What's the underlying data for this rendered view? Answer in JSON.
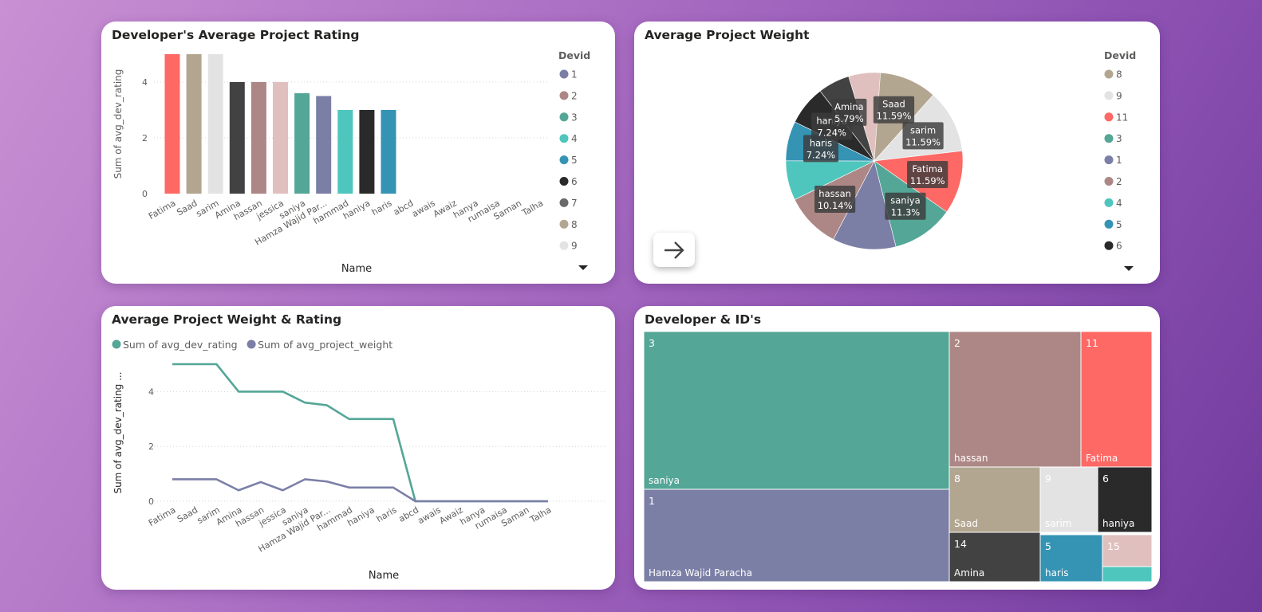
{
  "colors": {
    "1": "#7b7fa6",
    "2": "#ad8785",
    "3": "#54a697",
    "4": "#4fc6bd",
    "5": "#3593b4",
    "6": "#2a2a2a",
    "7": "#6a6a6a",
    "8": "#b3a691",
    "9": "#e3e3e3",
    "11": "#fe6865",
    "14": "#424242",
    "15": "#e0c0bf"
  },
  "bar_card": {
    "title": "Developer's Average Project Rating",
    "legend_title": "Devid",
    "legend_items": [
      "1",
      "2",
      "3",
      "4",
      "5",
      "6",
      "7",
      "8",
      "9"
    ]
  },
  "pie_card": {
    "title": "Average Project Weight",
    "legend_title": "Devid",
    "legend_items": [
      "8",
      "9",
      "11",
      "3",
      "1",
      "2",
      "4",
      "5",
      "6"
    ],
    "nav_icon": "arrow-right-icon"
  },
  "line_card": {
    "title": "Average Project Weight & Rating",
    "legend": [
      "Sum of avg_dev_rating",
      "Sum of avg_project_weight"
    ]
  },
  "treemap_card": {
    "title": "Developer & ID's"
  },
  "chart_data": [
    {
      "type": "bar",
      "title": "Developer's Average Project Rating",
      "xlabel": "Name",
      "ylabel": "Sum of avg_dev_rating",
      "ylim": [
        0,
        5
      ],
      "yticks": [
        0,
        2,
        4
      ],
      "grid": true,
      "legend_position": "right",
      "categories": [
        "Fatima",
        "Saad",
        "sarim",
        "Amina",
        "hassan",
        "jessica",
        "saniya",
        "Hamza Wajid Par...",
        "hammad",
        "haniya",
        "haris",
        "abcd",
        "awais",
        "Awaiz",
        "hanya",
        "rumaisa",
        "Saman",
        "Talha"
      ],
      "values": [
        5,
        5,
        5,
        4,
        4,
        4,
        3.6,
        3.5,
        3,
        3,
        3,
        0,
        0,
        0,
        0,
        0,
        0,
        0
      ],
      "devids": [
        "11",
        "8",
        "9",
        "14",
        "2",
        "15",
        "3",
        "1",
        "4",
        "6",
        "5",
        "",
        "",
        "",
        "",
        "",
        "",
        ""
      ]
    },
    {
      "type": "pie",
      "title": "Average Project Weight",
      "legend_position": "right",
      "slices": [
        {
          "devid": "8",
          "name": "Saad",
          "percent": 11.59
        },
        {
          "devid": "9",
          "name": "sarim",
          "percent": 11.59
        },
        {
          "devid": "11",
          "name": "Fatima",
          "percent": 11.59
        },
        {
          "devid": "3",
          "name": "saniya",
          "percent": 11.3
        },
        {
          "devid": "1",
          "name": "",
          "percent": 11.59
        },
        {
          "devid": "2",
          "name": "hassan",
          "percent": 10.14
        },
        {
          "devid": "4",
          "name": "",
          "percent": 7.24
        },
        {
          "devid": "5",
          "name": "haris",
          "percent": 7.24
        },
        {
          "devid": "6",
          "name": "haniya",
          "percent": 7.24
        },
        {
          "devid": "14",
          "name": "Amina",
          "percent": 5.79
        },
        {
          "devid": "15",
          "name": "",
          "percent": 5.79
        }
      ]
    },
    {
      "type": "line",
      "title": "Average Project Weight & Rating",
      "xlabel": "Name",
      "ylabel": "Sum of avg_dev_rating ...",
      "ylim": [
        0,
        5
      ],
      "yticks": [
        0,
        2,
        4
      ],
      "grid": true,
      "legend_position": "top-left",
      "categories": [
        "Fatima",
        "Saad",
        "sarim",
        "Amina",
        "hassan",
        "jessica",
        "saniya",
        "Hamza Wajid Par...",
        "hammad",
        "haniya",
        "haris",
        "abcd",
        "awais",
        "Awaiz",
        "hanya",
        "rumaisa",
        "Saman",
        "Talha"
      ],
      "series": [
        {
          "name": "Sum of avg_dev_rating",
          "values": [
            5,
            5,
            5,
            4,
            4,
            4,
            3.6,
            3.5,
            3,
            3,
            3,
            0,
            0,
            0,
            0,
            0,
            0,
            0
          ]
        },
        {
          "name": "Sum of avg_project_weight",
          "values": [
            0.8,
            0.8,
            0.8,
            0.4,
            0.7,
            0.4,
            0.8,
            0.72,
            0.5,
            0.5,
            0.5,
            0,
            0,
            0,
            0,
            0,
            0,
            0
          ]
        }
      ]
    },
    {
      "type": "treemap",
      "title": "Developer & ID's",
      "cells": [
        {
          "id": "3",
          "name": "saniya"
        },
        {
          "id": "1",
          "name": "Hamza Wajid Paracha"
        },
        {
          "id": "2",
          "name": "hassan"
        },
        {
          "id": "11",
          "name": "Fatima"
        },
        {
          "id": "8",
          "name": "Saad"
        },
        {
          "id": "9",
          "name": "sarim"
        },
        {
          "id": "6",
          "name": "haniya"
        },
        {
          "id": "14",
          "name": "Amina"
        },
        {
          "id": "5",
          "name": "haris"
        },
        {
          "id": "15",
          "name": ""
        },
        {
          "id": "4",
          "name": ""
        }
      ]
    }
  ]
}
